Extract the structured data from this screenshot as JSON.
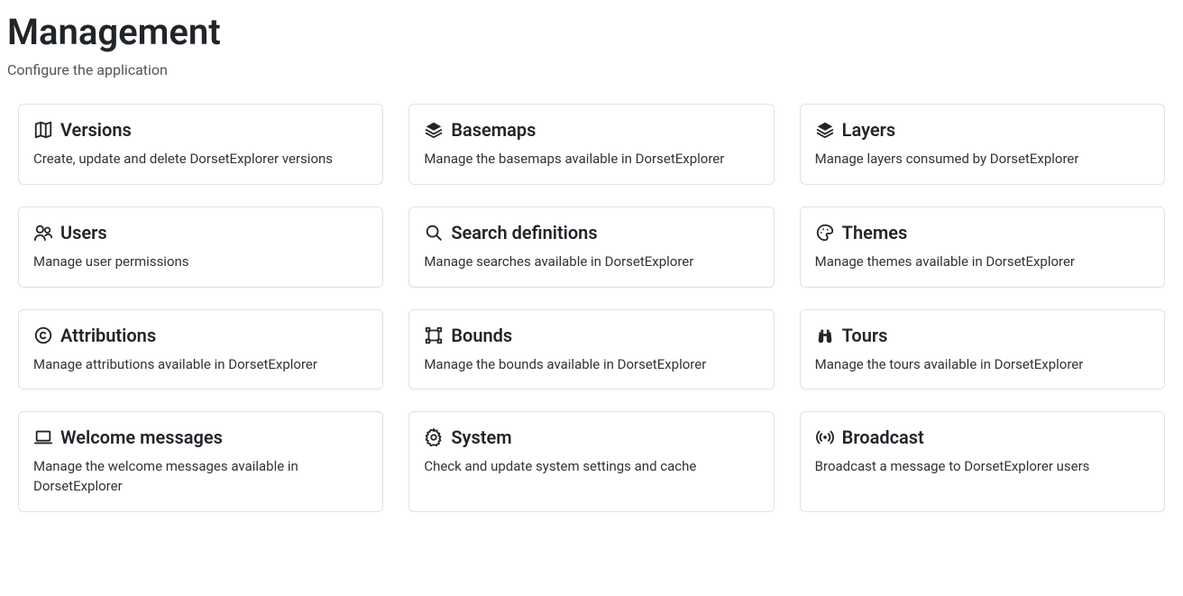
{
  "header": {
    "title": "Management",
    "subtitle": "Configure the application"
  },
  "cards": [
    {
      "icon": "map-icon",
      "title": "Versions",
      "desc": "Create, update and delete DorsetExplorer versions"
    },
    {
      "icon": "layers-icon",
      "title": "Basemaps",
      "desc": "Manage the basemaps available in DorsetExplorer"
    },
    {
      "icon": "layers-icon",
      "title": "Layers",
      "desc": "Manage layers consumed by DorsetExplorer"
    },
    {
      "icon": "users-icon",
      "title": "Users",
      "desc": "Manage user permissions"
    },
    {
      "icon": "search-icon",
      "title": "Search definitions",
      "desc": "Manage searches available in DorsetExplorer"
    },
    {
      "icon": "palette-icon",
      "title": "Themes",
      "desc": "Manage themes available in DorsetExplorer"
    },
    {
      "icon": "copyright-icon",
      "title": "Attributions",
      "desc": "Manage attributions available in DorsetExplorer"
    },
    {
      "icon": "bounds-icon",
      "title": "Bounds",
      "desc": "Manage the bounds available in DorsetExplorer"
    },
    {
      "icon": "binoculars-icon",
      "title": "Tours",
      "desc": "Manage the tours available in DorsetExplorer"
    },
    {
      "icon": "laptop-icon",
      "title": "Welcome messages",
      "desc": "Manage the welcome messages available in DorsetExplorer"
    },
    {
      "icon": "gear-icon",
      "title": "System",
      "desc": "Check and update system settings and cache"
    },
    {
      "icon": "broadcast-icon",
      "title": "Broadcast",
      "desc": "Broadcast a message to DorsetExplorer users"
    }
  ]
}
